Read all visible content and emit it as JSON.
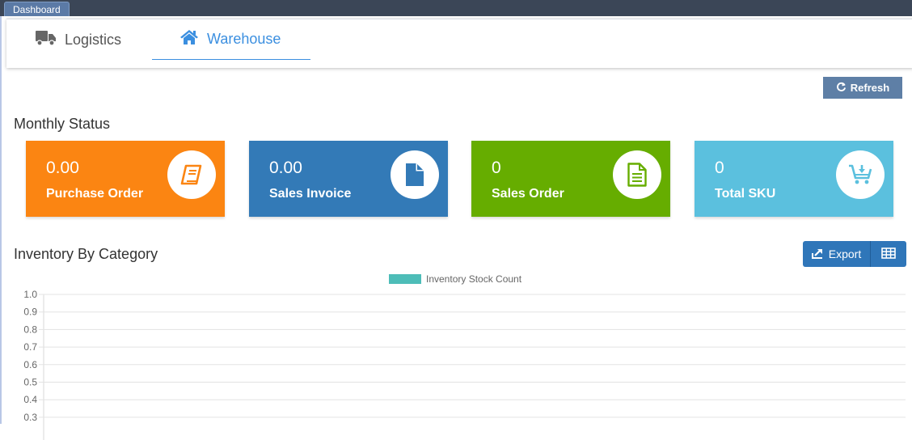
{
  "window": {
    "tab_label": "Dashboard"
  },
  "tabs": [
    {
      "label": "Logistics",
      "icon": "truck-icon",
      "active": false
    },
    {
      "label": "Warehouse",
      "icon": "home-icon",
      "active": true
    }
  ],
  "toolbar": {
    "refresh_label": "Refresh"
  },
  "monthly_status": {
    "title": "Monthly Status",
    "cards": [
      {
        "value": "0.00",
        "label": "Purchase Order",
        "icon": "book-icon",
        "color": "#fb8512"
      },
      {
        "value": "0.00",
        "label": "Sales Invoice",
        "icon": "file-icon",
        "color": "#337ab7"
      },
      {
        "value": "0",
        "label": "Sales Order",
        "icon": "document-lines-icon",
        "color": "#66ad00"
      },
      {
        "value": "0",
        "label": "Total SKU",
        "icon": "cart-download-icon",
        "color": "#5bc0de"
      }
    ]
  },
  "inventory": {
    "title": "Inventory By Category",
    "export_label": "Export"
  },
  "chart_data": {
    "type": "bar",
    "categories": [],
    "series": [
      {
        "name": "Inventory Stock Count",
        "values": [],
        "color": "#4dbdb8"
      }
    ],
    "ylim": [
      0,
      1.0
    ],
    "yticks": [
      "1.0",
      "0.9",
      "0.8",
      "0.7",
      "0.6",
      "0.5",
      "0.4",
      "0.3"
    ],
    "legend": "top-center",
    "grid": true
  }
}
